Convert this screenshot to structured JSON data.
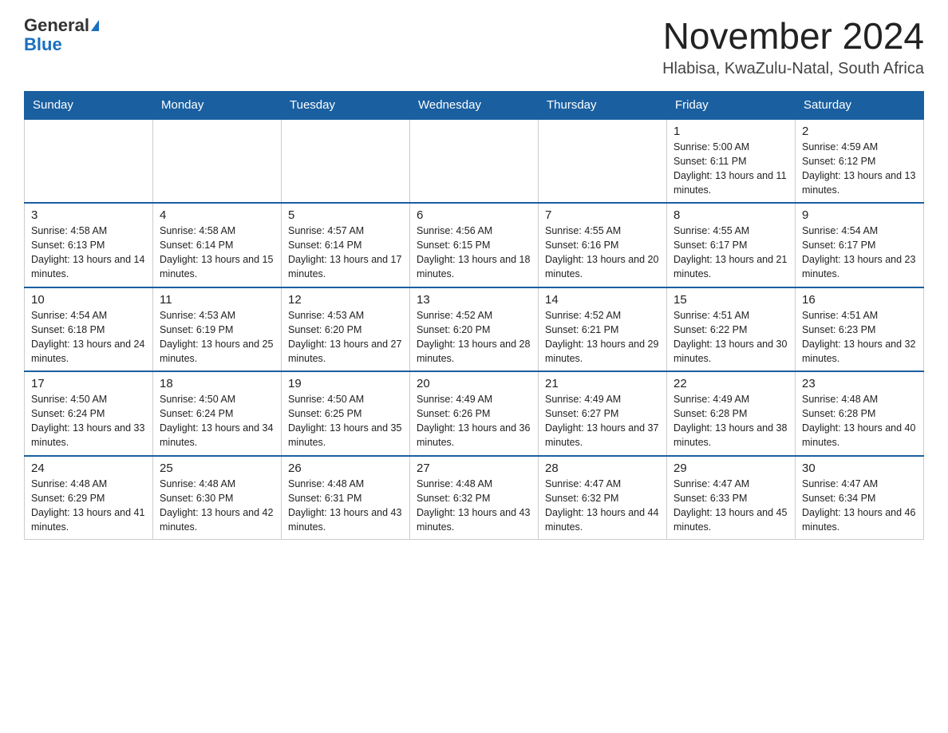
{
  "header": {
    "logo_general": "General",
    "logo_blue": "Blue",
    "title": "November 2024",
    "subtitle": "Hlabisa, KwaZulu-Natal, South Africa"
  },
  "days_of_week": [
    "Sunday",
    "Monday",
    "Tuesday",
    "Wednesday",
    "Thursday",
    "Friday",
    "Saturday"
  ],
  "weeks": [
    [
      {
        "day": "",
        "info": ""
      },
      {
        "day": "",
        "info": ""
      },
      {
        "day": "",
        "info": ""
      },
      {
        "day": "",
        "info": ""
      },
      {
        "day": "",
        "info": ""
      },
      {
        "day": "1",
        "info": "Sunrise: 5:00 AM\nSunset: 6:11 PM\nDaylight: 13 hours and 11 minutes."
      },
      {
        "day": "2",
        "info": "Sunrise: 4:59 AM\nSunset: 6:12 PM\nDaylight: 13 hours and 13 minutes."
      }
    ],
    [
      {
        "day": "3",
        "info": "Sunrise: 4:58 AM\nSunset: 6:13 PM\nDaylight: 13 hours and 14 minutes."
      },
      {
        "day": "4",
        "info": "Sunrise: 4:58 AM\nSunset: 6:14 PM\nDaylight: 13 hours and 15 minutes."
      },
      {
        "day": "5",
        "info": "Sunrise: 4:57 AM\nSunset: 6:14 PM\nDaylight: 13 hours and 17 minutes."
      },
      {
        "day": "6",
        "info": "Sunrise: 4:56 AM\nSunset: 6:15 PM\nDaylight: 13 hours and 18 minutes."
      },
      {
        "day": "7",
        "info": "Sunrise: 4:55 AM\nSunset: 6:16 PM\nDaylight: 13 hours and 20 minutes."
      },
      {
        "day": "8",
        "info": "Sunrise: 4:55 AM\nSunset: 6:17 PM\nDaylight: 13 hours and 21 minutes."
      },
      {
        "day": "9",
        "info": "Sunrise: 4:54 AM\nSunset: 6:17 PM\nDaylight: 13 hours and 23 minutes."
      }
    ],
    [
      {
        "day": "10",
        "info": "Sunrise: 4:54 AM\nSunset: 6:18 PM\nDaylight: 13 hours and 24 minutes."
      },
      {
        "day": "11",
        "info": "Sunrise: 4:53 AM\nSunset: 6:19 PM\nDaylight: 13 hours and 25 minutes."
      },
      {
        "day": "12",
        "info": "Sunrise: 4:53 AM\nSunset: 6:20 PM\nDaylight: 13 hours and 27 minutes."
      },
      {
        "day": "13",
        "info": "Sunrise: 4:52 AM\nSunset: 6:20 PM\nDaylight: 13 hours and 28 minutes."
      },
      {
        "day": "14",
        "info": "Sunrise: 4:52 AM\nSunset: 6:21 PM\nDaylight: 13 hours and 29 minutes."
      },
      {
        "day": "15",
        "info": "Sunrise: 4:51 AM\nSunset: 6:22 PM\nDaylight: 13 hours and 30 minutes."
      },
      {
        "day": "16",
        "info": "Sunrise: 4:51 AM\nSunset: 6:23 PM\nDaylight: 13 hours and 32 minutes."
      }
    ],
    [
      {
        "day": "17",
        "info": "Sunrise: 4:50 AM\nSunset: 6:24 PM\nDaylight: 13 hours and 33 minutes."
      },
      {
        "day": "18",
        "info": "Sunrise: 4:50 AM\nSunset: 6:24 PM\nDaylight: 13 hours and 34 minutes."
      },
      {
        "day": "19",
        "info": "Sunrise: 4:50 AM\nSunset: 6:25 PM\nDaylight: 13 hours and 35 minutes."
      },
      {
        "day": "20",
        "info": "Sunrise: 4:49 AM\nSunset: 6:26 PM\nDaylight: 13 hours and 36 minutes."
      },
      {
        "day": "21",
        "info": "Sunrise: 4:49 AM\nSunset: 6:27 PM\nDaylight: 13 hours and 37 minutes."
      },
      {
        "day": "22",
        "info": "Sunrise: 4:49 AM\nSunset: 6:28 PM\nDaylight: 13 hours and 38 minutes."
      },
      {
        "day": "23",
        "info": "Sunrise: 4:48 AM\nSunset: 6:28 PM\nDaylight: 13 hours and 40 minutes."
      }
    ],
    [
      {
        "day": "24",
        "info": "Sunrise: 4:48 AM\nSunset: 6:29 PM\nDaylight: 13 hours and 41 minutes."
      },
      {
        "day": "25",
        "info": "Sunrise: 4:48 AM\nSunset: 6:30 PM\nDaylight: 13 hours and 42 minutes."
      },
      {
        "day": "26",
        "info": "Sunrise: 4:48 AM\nSunset: 6:31 PM\nDaylight: 13 hours and 43 minutes."
      },
      {
        "day": "27",
        "info": "Sunrise: 4:48 AM\nSunset: 6:32 PM\nDaylight: 13 hours and 43 minutes."
      },
      {
        "day": "28",
        "info": "Sunrise: 4:47 AM\nSunset: 6:32 PM\nDaylight: 13 hours and 44 minutes."
      },
      {
        "day": "29",
        "info": "Sunrise: 4:47 AM\nSunset: 6:33 PM\nDaylight: 13 hours and 45 minutes."
      },
      {
        "day": "30",
        "info": "Sunrise: 4:47 AM\nSunset: 6:34 PM\nDaylight: 13 hours and 46 minutes."
      }
    ]
  ]
}
